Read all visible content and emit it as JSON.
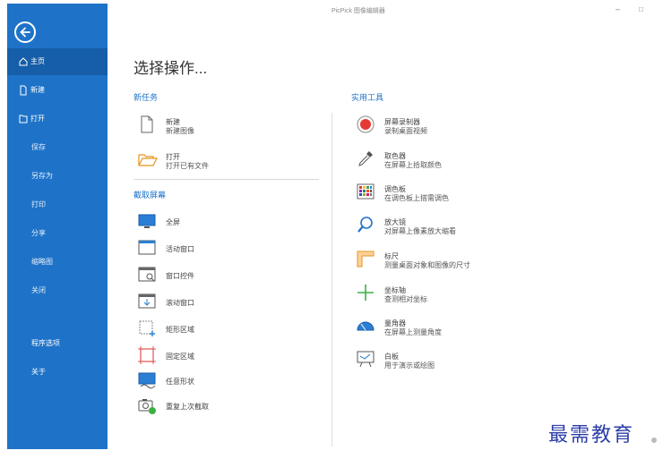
{
  "app": {
    "title": "PicPick 图像编辑器",
    "minimize": "–",
    "maximize": "□"
  },
  "sidebar": {
    "items": [
      {
        "label": "主页",
        "icon": "home-icon"
      },
      {
        "label": "新建",
        "icon": "new-file-icon"
      },
      {
        "label": "打开",
        "icon": "open-folder-icon"
      },
      {
        "label": "保存"
      },
      {
        "label": "另存为"
      },
      {
        "label": "打印"
      },
      {
        "label": "分享"
      },
      {
        "label": "缩略图"
      },
      {
        "label": "关闭"
      },
      {
        "label": "程序选项"
      },
      {
        "label": "关于"
      }
    ]
  },
  "main": {
    "heading": "选择操作...",
    "new_task": {
      "title": "新任务",
      "items": [
        {
          "line1": "新建",
          "line2": "新建图像",
          "icon": "blank-page-icon"
        },
        {
          "line1": "打开",
          "line2": "打开已有文件",
          "icon": "open-folder-icon"
        }
      ]
    },
    "capture": {
      "title": "截取屏幕",
      "items": [
        {
          "label": "全屏",
          "icon": "monitor-icon"
        },
        {
          "label": "活动窗口",
          "icon": "active-window-icon"
        },
        {
          "label": "窗口控件",
          "icon": "window-control-icon"
        },
        {
          "label": "滚动窗口",
          "icon": "scrolling-window-icon"
        },
        {
          "label": "矩形区域",
          "icon": "rect-region-icon"
        },
        {
          "label": "固定区域",
          "icon": "fixed-region-icon"
        },
        {
          "label": "任意形状",
          "icon": "freehand-icon"
        },
        {
          "label": "重复上次截取",
          "icon": "repeat-capture-icon"
        }
      ]
    },
    "tools": {
      "title": "实用工具",
      "items": [
        {
          "line1": "屏幕录制器",
          "line2": "录制桌面视频",
          "icon": "record-icon"
        },
        {
          "line1": "取色器",
          "line2": "在屏幕上拾取颜色",
          "icon": "eyedropper-icon"
        },
        {
          "line1": "调色板",
          "line2": "在调色板上搭需调色",
          "icon": "palette-icon"
        },
        {
          "line1": "放大镜",
          "line2": "对屏幕上像素放大缩看",
          "icon": "magnifier-icon"
        },
        {
          "line1": "标尺",
          "line2": "测量桌面对象和图像的尺寸",
          "icon": "ruler-icon"
        },
        {
          "line1": "坐标轴",
          "line2": "查测相对坐标",
          "icon": "crosshair-icon"
        },
        {
          "line1": "量角器",
          "line2": "在屏幕上测量角度",
          "icon": "protractor-icon"
        },
        {
          "line1": "白板",
          "line2": "用于演示或绘图",
          "icon": "whiteboard-icon"
        }
      ]
    }
  },
  "watermark": {
    "text": "最需教育"
  },
  "colors": {
    "sidebar": "#1e73c8",
    "accent": "#1e73c8",
    "record": "#e53935"
  }
}
